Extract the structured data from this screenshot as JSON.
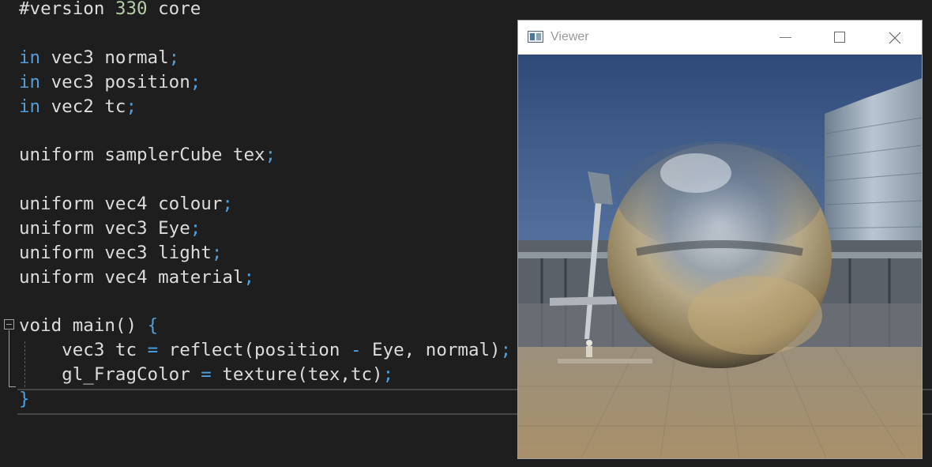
{
  "editor": {
    "lines": [
      {
        "text": "#version 330 core"
      },
      {
        "text": "in vec3 normal;"
      },
      {
        "text": "in vec3 position;"
      },
      {
        "text": "in vec2 tc;"
      },
      {
        "text": "uniform samplerCube tex;"
      },
      {
        "text": "uniform vec4 colour;"
      },
      {
        "text": "uniform vec3 Eye;"
      },
      {
        "text": "uniform vec3 light;"
      },
      {
        "text": "uniform vec4 material;"
      },
      {
        "text": "void main() {"
      },
      {
        "text": "    vec3 tc = reflect(position - Eye, normal);"
      },
      {
        "text": "    gl_FragColor = texture(tex,tc);"
      },
      {
        "text": "}"
      }
    ],
    "tokens": {
      "l0_a": "#version ",
      "l0_b": "330",
      "l0_c": " core",
      "l1_a": "in",
      "l1_b": " vec3 normal",
      "l1_c": ";",
      "l2_a": "in",
      "l2_b": " vec3 position",
      "l2_c": ";",
      "l3_a": "in",
      "l3_b": " vec2 tc",
      "l3_c": ";",
      "l4_a": "uniform samplerCube tex",
      "l4_b": ";",
      "l5_a": "uniform vec4 colour",
      "l5_b": ";",
      "l6_a": "uniform vec3 Eye",
      "l6_b": ";",
      "l7_a": "uniform vec3 light",
      "l7_b": ";",
      "l8_a": "uniform vec4 material",
      "l8_b": ";",
      "l9_a": "void main() ",
      "l9_b": "{",
      "l10_a": "    vec3 tc ",
      "l10_b": "=",
      "l10_c": " reflect(position ",
      "l10_d": "-",
      "l10_e": " Eye, normal)",
      "l10_f": ";",
      "l11_a": "    gl_FragColor ",
      "l11_b": "=",
      "l11_c": " texture(tex,tc)",
      "l11_d": ";",
      "l12_a": "}"
    }
  },
  "viewer": {
    "title": "Viewer",
    "icon": "app-window-icon",
    "controls": [
      "minimize-icon",
      "maximize-icon",
      "close-icon"
    ]
  },
  "colors": {
    "editor_bg": "#1e1e1e",
    "keyword": "#569cd6",
    "number": "#b5cea8",
    "text": "#dcdcdc"
  }
}
